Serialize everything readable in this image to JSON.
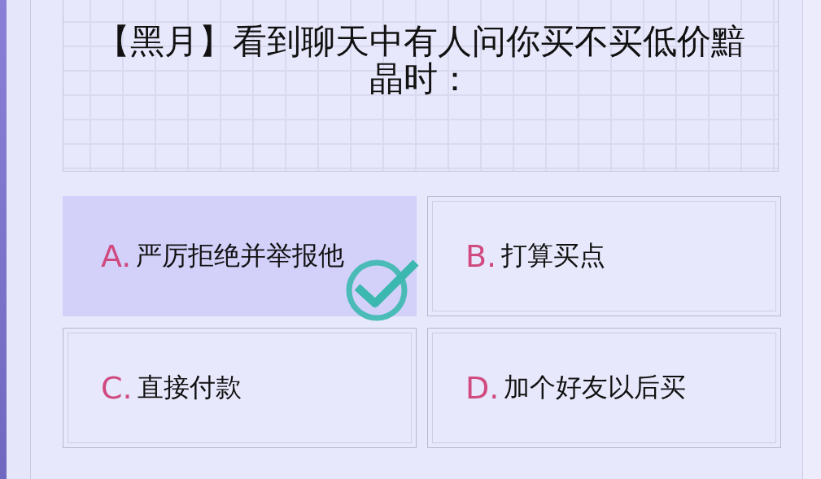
{
  "question": "【黑月】看到聊天中有人问你买不买低价黯晶时：",
  "options": [
    {
      "letter": "A.",
      "text": "严厉拒绝并举报他",
      "selected": true,
      "correct": true
    },
    {
      "letter": "B.",
      "text": "打算买点",
      "selected": false,
      "correct": false
    },
    {
      "letter": "C.",
      "text": "直接付款",
      "selected": false,
      "correct": false
    },
    {
      "letter": "D.",
      "text": "加个好友以后买",
      "selected": false,
      "correct": false
    }
  ]
}
